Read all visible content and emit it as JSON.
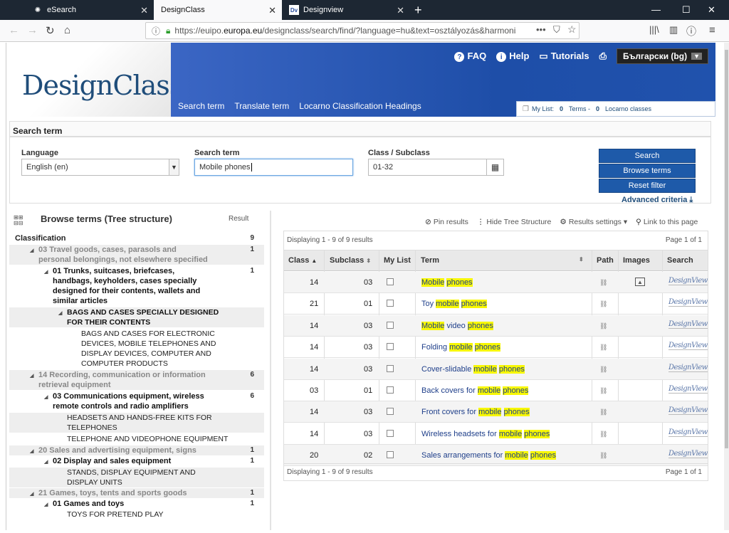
{
  "browser": {
    "tabs": [
      {
        "label": "eSearch",
        "icon": "esearch-icon"
      },
      {
        "label": "DesignClass",
        "icon": ""
      },
      {
        "label": "Designview",
        "icon": "designview-icon",
        "icon_text": "Dv"
      }
    ],
    "url_prefix": "https://euipo.",
    "url_domain": "europa.eu",
    "url_rest": "/designclass/search/find/?language=hu&text=osztályozás&harmonisedO"
  },
  "header": {
    "logo": "DesignClass",
    "links": {
      "faq": "FAQ",
      "help": "Help",
      "tutorials": "Tutorials"
    },
    "language": "Български (bg)",
    "nav": [
      "Search term",
      "Translate term",
      "Locarno Classification Headings"
    ],
    "mylist": {
      "label": "My List:",
      "terms_count": "0",
      "terms_label": "Terms -",
      "classes_count": "0",
      "classes_label": "Locarno classes"
    }
  },
  "search": {
    "title": "Search term",
    "language_label": "Language",
    "language_value": "English (en)",
    "term_label": "Search term",
    "term_value": "Mobile phones",
    "class_label": "Class / Subclass",
    "class_value": "01-32",
    "btn_search": "Search",
    "btn_browse": "Browse terms",
    "btn_reset": "Reset filter",
    "advanced": "Advanced criteria"
  },
  "tree": {
    "title": "Browse terms (Tree structure)",
    "result_label": "Result",
    "root": {
      "label": "Classification",
      "count": "9"
    },
    "nodes": [
      {
        "l1": "03 Travel goods, cases, parasols and",
        "l2": "personal belongings, not elsewhere specified",
        "count": "1"
      },
      {
        "l1": "01 Trunks, suitcases, briefcases,",
        "l2": "handbags, keyholders, cases specially",
        "l3": "designed for their contents, wallets and",
        "l4": "similar articles",
        "count": "1"
      },
      {
        "l1": "BAGS AND CASES SPECIALLY DESIGNED",
        "l2": "FOR THEIR CONTENTS"
      },
      {
        "l1": "BAGS AND CASES FOR ELECTRONIC",
        "l2": "DEVICES, MOBILE TELEPHONES AND",
        "l3": "DISPLAY DEVICES, COMPUTER AND",
        "l4": "COMPUTER PRODUCTS"
      },
      {
        "l1": "14 Recording, communication or information",
        "l2": "retrieval equipment",
        "count": "6"
      },
      {
        "l1": "03 Communications equipment, wireless",
        "l2": "remote controls and radio amplifiers",
        "count": "6"
      },
      {
        "l1": "HEADSETS AND HANDS-FREE KITS FOR",
        "l2": "TELEPHONES"
      },
      {
        "l1": "TELEPHONE AND VIDEOPHONE EQUIPMENT"
      },
      {
        "l1": "20 Sales and advertising equipment, signs",
        "count": "1"
      },
      {
        "l1": "02 Display and sales equipment",
        "count": "1"
      },
      {
        "l1": "STANDS, DISPLAY EQUIPMENT AND",
        "l2": "DISPLAY UNITS"
      },
      {
        "l1": "21 Games, toys, tents and sports goods",
        "count": "1"
      },
      {
        "l1": "01 Games and toys",
        "count": "1"
      },
      {
        "l1": "TOYS FOR PRETEND PLAY"
      }
    ]
  },
  "toolbar": {
    "pin": "Pin results",
    "hide": "Hide Tree Structure",
    "settings": "Results settings",
    "link": "Link to this page"
  },
  "results": {
    "displaying": "Displaying 1 - 9 of 9 results",
    "page": "Page 1 of 1",
    "columns": {
      "class": "Class",
      "subclass": "Subclass",
      "mylist": "My List",
      "term": "Term",
      "path": "Path",
      "images": "Images",
      "search": "Search"
    },
    "dv_label": "DesignView",
    "rows": [
      {
        "class": "14",
        "subclass": "03",
        "pre": "",
        "h1": "Mobile",
        "mid": " ",
        "h2": "phones",
        "has_image": true
      },
      {
        "class": "21",
        "subclass": "01",
        "pre": "Toy ",
        "h1": "mobile",
        "mid": " ",
        "h2": "phones",
        "has_image": false
      },
      {
        "class": "14",
        "subclass": "03",
        "pre": "",
        "h1": "Mobile",
        "mid": " video ",
        "h2": "phones",
        "has_image": false
      },
      {
        "class": "14",
        "subclass": "03",
        "pre": "Folding ",
        "h1": "mobile",
        "mid": " ",
        "h2": "phones",
        "has_image": false
      },
      {
        "class": "14",
        "subclass": "03",
        "pre": "Cover-slidable ",
        "h1": "mobile",
        "mid": " ",
        "h2": "phones",
        "has_image": false
      },
      {
        "class": "03",
        "subclass": "01",
        "pre": "Back covers for ",
        "h1": "mobile",
        "mid": " ",
        "h2": "phones",
        "has_image": false
      },
      {
        "class": "14",
        "subclass": "03",
        "pre": "Front covers for ",
        "h1": "mobile",
        "mid": " ",
        "h2": "phones",
        "has_image": false
      },
      {
        "class": "14",
        "subclass": "03",
        "pre": "Wireless headsets for ",
        "h1": "mobile",
        "mid": " ",
        "h2": "phones",
        "has_image": false
      },
      {
        "class": "20",
        "subclass": "02",
        "pre": "Sales arrangements for ",
        "h1": "mobile",
        "mid": " ",
        "h2": "phones",
        "has_image": false
      }
    ]
  }
}
